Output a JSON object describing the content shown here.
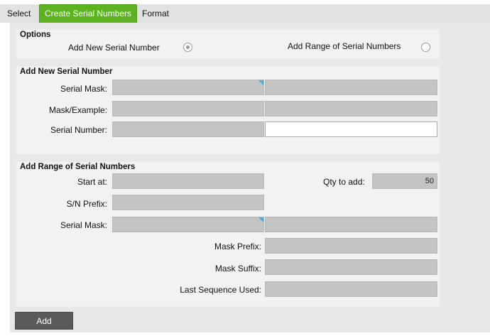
{
  "tabs": [
    {
      "label": "Select"
    },
    {
      "label": "Create Serial Numbers"
    },
    {
      "label": "Format"
    }
  ],
  "colors": {
    "active_tab": "#5cb31f",
    "accent_corner": "#5aa7d6"
  },
  "options": {
    "title": "Options",
    "add_new_label": "Add New Serial Number",
    "add_new_selected": true,
    "add_range_label": "Add Range of Serial Numbers",
    "add_range_selected": false
  },
  "add_new": {
    "title": "Add New Serial Number",
    "serial_mask_label": "Serial Mask:",
    "mask_example_label": "Mask/Example:",
    "serial_number_label": "Serial Number:"
  },
  "add_range": {
    "title": "Add Range of Serial Numbers",
    "start_at_label": "Start at:",
    "qty_label": "Qty to add:",
    "qty_value": "50",
    "sn_prefix_label": "S/N Prefix:",
    "serial_mask_label": "Serial Mask:",
    "mask_prefix_label": "Mask Prefix:",
    "mask_suffix_label": "Mask Suffix:",
    "last_seq_label": "Last Sequence Used:"
  },
  "actions": {
    "add_label": "Add"
  }
}
